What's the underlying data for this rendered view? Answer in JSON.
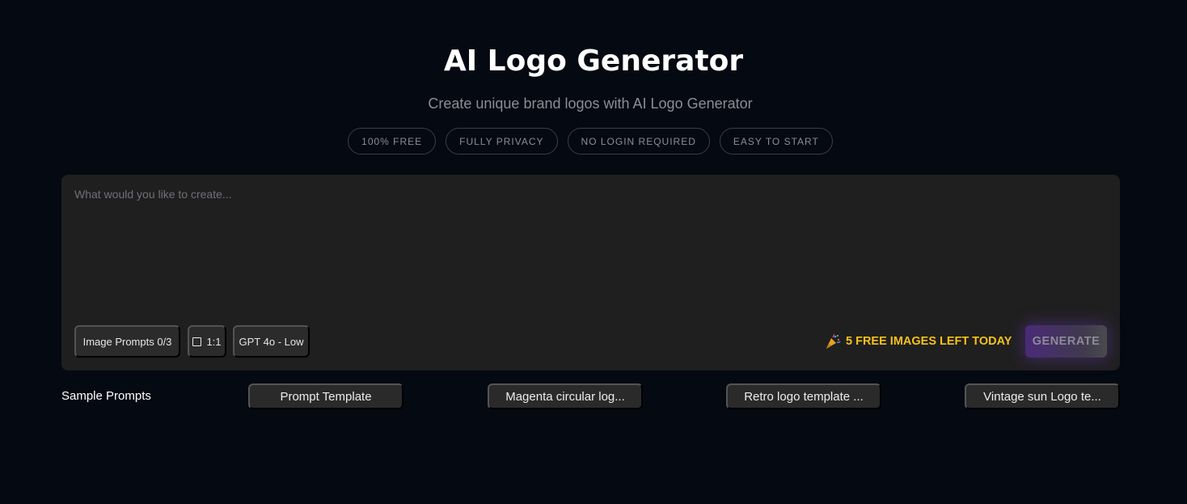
{
  "header": {
    "title": "AI Logo Generator",
    "subtitle": "Create unique brand logos with AI Logo Generator"
  },
  "badges": [
    "100% FREE",
    "FULLY PRIVACY",
    "NO LOGIN REQUIRED",
    "EASY TO START"
  ],
  "prompt": {
    "value": "",
    "placeholder": "What would you like to create..."
  },
  "options": {
    "image_prompts": "Image Prompts 0/3",
    "ratio": "1:1",
    "model": "GPT 4o - Low"
  },
  "quota": {
    "icon": "party-popper-icon",
    "text": "5 FREE IMAGES LEFT TODAY"
  },
  "generate_label": "GENERATE",
  "samples": {
    "label": "Sample Prompts",
    "items": [
      "Prompt Template",
      "Magenta circular log...",
      "Retro logo template ...",
      "Vintage sun Logo te..."
    ]
  },
  "colors": {
    "background": "#050912",
    "panel": "#1f1f1f",
    "accent_yellow": "#f5c21b",
    "generate_purple": "#4a2a78"
  }
}
